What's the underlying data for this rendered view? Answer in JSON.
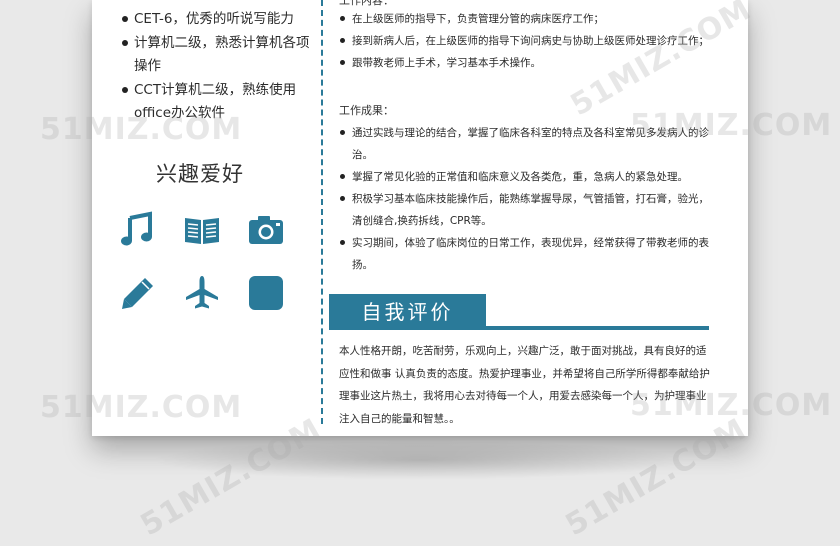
{
  "skills": [
    "CET-6，优秀的听说写能力",
    "计算机二级，熟悉计算机各项操作",
    "CCT计算机二级，熟练使用office办公软件"
  ],
  "hobby": {
    "title": "兴趣爱好",
    "icons": [
      "music-note-icon",
      "book-icon",
      "camera-icon",
      "pencil-icon",
      "airplane-icon",
      "square-icon"
    ]
  },
  "work": {
    "content_label": "工作内容：",
    "duties": [
      "在上级医师的指导下，负责管理分管的病床医疗工作；",
      "接到新病人后，在上级医师的指导下询问病史与协助上级医师处理诊疗工作；",
      "跟带教老师上手术，学习基本手术操作。"
    ],
    "results_label": "工作成果：",
    "results": [
      "通过实践与理论的结合，掌握了临床各科室的特点及各科室常见多发病人的诊治。",
      "掌握了常见化验的正常值和临床意义及各类危，重，急病人的紧急处理。",
      "积极学习基本临床技能操作后，能熟练掌握导尿，气管插管，打石膏，验光，清创缝合,换药拆线，CPR等。",
      "实习期间，体验了临床岗位的日常工作，表现优异，经常获得了带教老师的表扬。"
    ]
  },
  "self_eval": {
    "title": "自我评价",
    "text": "本人性格开朗，吃苦耐劳，乐观向上，兴趣广泛，敢于面对挑战，具有良好的适应性和做事 认真负责的态度。热爱护理事业，并希望将自己所学所得都奉献给护理事业这片热土，我将用心去对待每一个人，用爱去感染每一个人，为护理事业注入自己的能量和智慧。。"
  },
  "colors": {
    "accent": "#2a7a99"
  },
  "watermark": "51MIZ.COM"
}
